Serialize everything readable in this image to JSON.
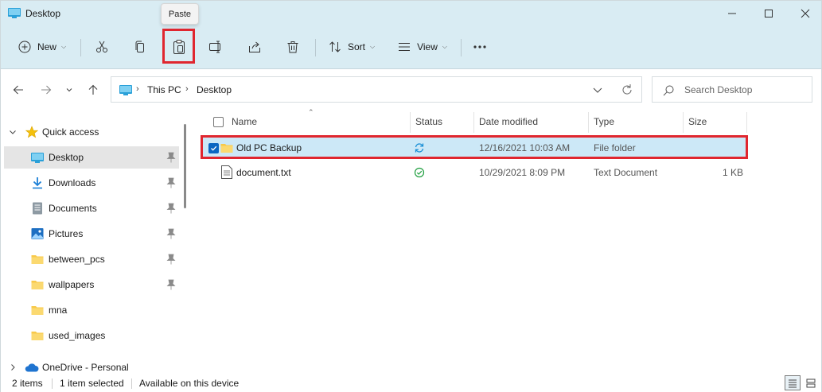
{
  "window": {
    "title": "Desktop",
    "tooltip": "Paste"
  },
  "toolbar": {
    "new_label": "New",
    "sort_label": "Sort",
    "view_label": "View",
    "buttons": [
      "cut-icon",
      "copy-icon",
      "paste-icon",
      "rename-icon",
      "share-icon",
      "delete-icon",
      "more-icon"
    ]
  },
  "address": {
    "crumbs": [
      "This PC",
      "Desktop"
    ]
  },
  "search": {
    "placeholder": "Search Desktop"
  },
  "navpane": {
    "quick_access_label": "Quick access",
    "items": [
      {
        "label": "Desktop",
        "icon": "desktop-icon",
        "pinned": true,
        "selected": true
      },
      {
        "label": "Downloads",
        "icon": "downloads-icon",
        "pinned": true
      },
      {
        "label": "Documents",
        "icon": "documents-icon",
        "pinned": true
      },
      {
        "label": "Pictures",
        "icon": "pictures-icon",
        "pinned": true
      },
      {
        "label": "between_pcs",
        "icon": "folder-icon",
        "pinned": true
      },
      {
        "label": "wallpapers",
        "icon": "folder-icon",
        "pinned": true
      },
      {
        "label": "mna",
        "icon": "folder-icon",
        "pinned": false
      },
      {
        "label": "used_images",
        "icon": "folder-icon",
        "pinned": false
      }
    ],
    "onedrive_label": "OneDrive - Personal"
  },
  "columns": {
    "name": "Name",
    "status": "Status",
    "date": "Date modified",
    "type": "Type",
    "size": "Size"
  },
  "files": [
    {
      "name": "Old PC Backup",
      "status_icon": "sync-icon",
      "date": "12/16/2021 10:03 AM",
      "type": "File folder",
      "size": "",
      "selected": true
    },
    {
      "name": "document.txt",
      "status_icon": "available-icon",
      "date": "10/29/2021 8:09 PM",
      "type": "Text Document",
      "size": "1 KB",
      "selected": false
    }
  ],
  "statusbar": {
    "count": "2 items",
    "selection": "1 item selected",
    "availability": "Available on this device"
  },
  "colors": {
    "chrome": "#d9ecf3",
    "selection": "#cce8f7",
    "highlight_box": "#e0262f",
    "accent": "#0a66c2"
  }
}
